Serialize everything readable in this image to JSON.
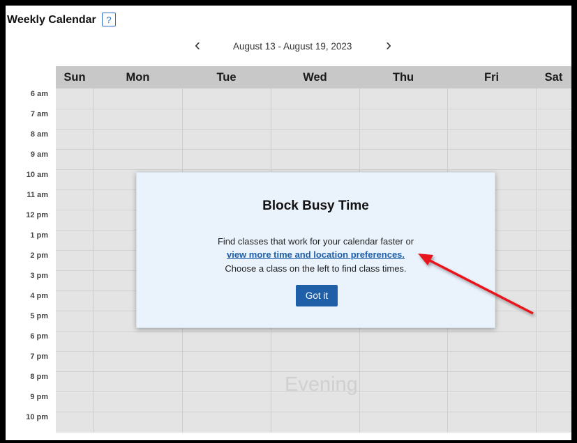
{
  "header": {
    "title": "Weekly Calendar",
    "help_icon": "?"
  },
  "navigation": {
    "prev_icon": "‹",
    "next_icon": "›",
    "week_range": "August 13 - August 19, 2023"
  },
  "days": [
    "Sun",
    "Mon",
    "Tue",
    "Wed",
    "Thu",
    "Fri",
    "Sat"
  ],
  "times": [
    "6 am",
    "7 am",
    "8 am",
    "9 am",
    "10 am",
    "11 am",
    "12 pm",
    "1 pm",
    "2 pm",
    "3 pm",
    "4 pm",
    "5 pm",
    "6 pm",
    "7 pm",
    "8 pm",
    "9 pm",
    "10 pm"
  ],
  "evening_label": "Evening",
  "modal": {
    "title": "Block Busy Time",
    "line1": "Find classes that work for your calendar faster or",
    "link": "view more time and location preferences.",
    "line3": "Choose a class on the left to find class times.",
    "button": "Got it"
  },
  "colors": {
    "accent": "#1f5fa8",
    "annotation": "#e8141b",
    "grid": "#e4e4e4",
    "header": "#c8c8c8"
  }
}
